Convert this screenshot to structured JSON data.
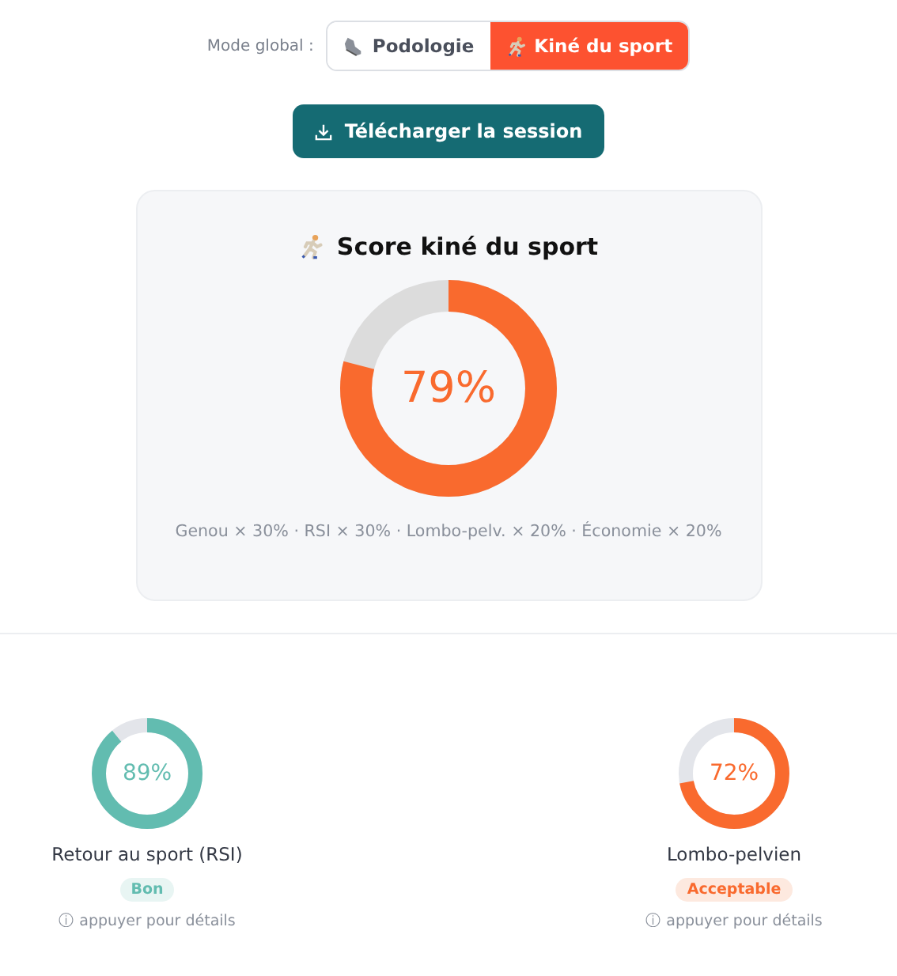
{
  "mode": {
    "label": "Mode global :",
    "options": [
      {
        "label": "Podologie",
        "kind": "shoe",
        "selected": false
      },
      {
        "label": "Kiné du sport",
        "kind": "runner",
        "selected": true
      }
    ]
  },
  "download_button": {
    "label": "Télécharger la session"
  },
  "score_card": {
    "title": "Score kiné du sport",
    "value": "79%",
    "formula": "Genou × 30% · RSI × 30% · Lombo-pelv. × 20% · Économie × 20%"
  },
  "metrics": [
    {
      "name": "Retour au sport (RSI)",
      "value": "89%",
      "kind": "good",
      "badge": "Bon",
      "hint": "ⓘ appuyer pour détails"
    },
    {
      "name": "Lombo-pelvien",
      "value": "72%",
      "kind": "ok",
      "badge": "Acceptable",
      "hint": "ⓘ appuyer pour détails"
    }
  ]
}
